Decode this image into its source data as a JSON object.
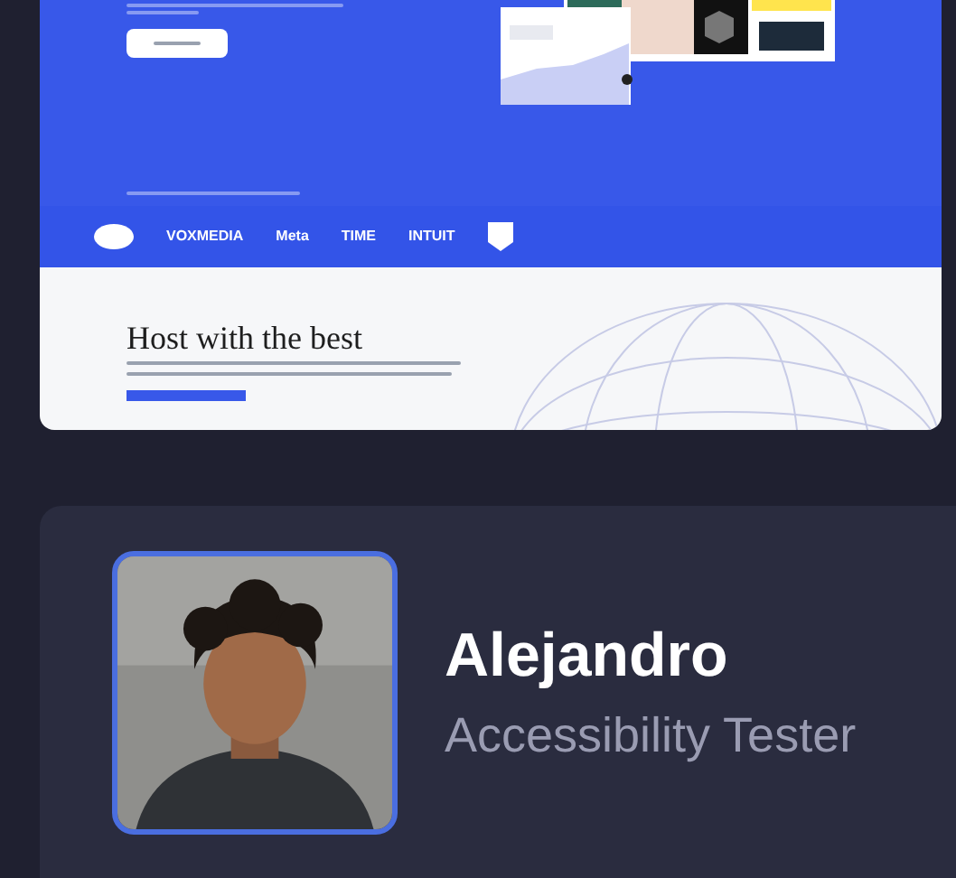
{
  "website_preview": {
    "logos": [
      "VOXMEDIA",
      "Meta",
      "TIME",
      "INTUIT"
    ],
    "heading": "Host with the best"
  },
  "profile": {
    "name": "Alejandro",
    "role": "Accessibility Tester"
  }
}
